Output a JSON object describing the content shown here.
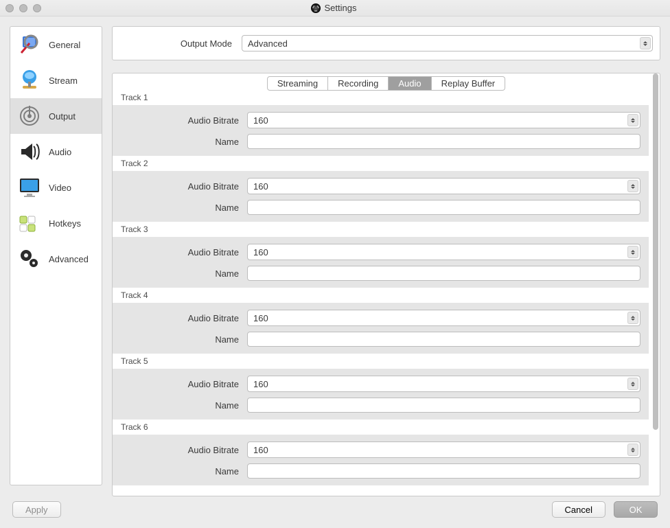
{
  "window": {
    "title": "Settings"
  },
  "sidebar": {
    "items": [
      {
        "label": "General"
      },
      {
        "label": "Stream"
      },
      {
        "label": "Output"
      },
      {
        "label": "Audio"
      },
      {
        "label": "Video"
      },
      {
        "label": "Hotkeys"
      },
      {
        "label": "Advanced"
      }
    ],
    "selected_index": 2
  },
  "output_mode": {
    "label": "Output Mode",
    "value": "Advanced"
  },
  "tabs": {
    "items": [
      "Streaming",
      "Recording",
      "Audio",
      "Replay Buffer"
    ],
    "selected_index": 2
  },
  "field_labels": {
    "audio_bitrate": "Audio Bitrate",
    "name": "Name"
  },
  "tracks": [
    {
      "title": "Track 1",
      "bitrate": "160",
      "name": ""
    },
    {
      "title": "Track 2",
      "bitrate": "160",
      "name": ""
    },
    {
      "title": "Track 3",
      "bitrate": "160",
      "name": ""
    },
    {
      "title": "Track 4",
      "bitrate": "160",
      "name": ""
    },
    {
      "title": "Track 5",
      "bitrate": "160",
      "name": ""
    },
    {
      "title": "Track 6",
      "bitrate": "160",
      "name": ""
    }
  ],
  "footer": {
    "apply": "Apply",
    "cancel": "Cancel",
    "ok": "OK"
  }
}
